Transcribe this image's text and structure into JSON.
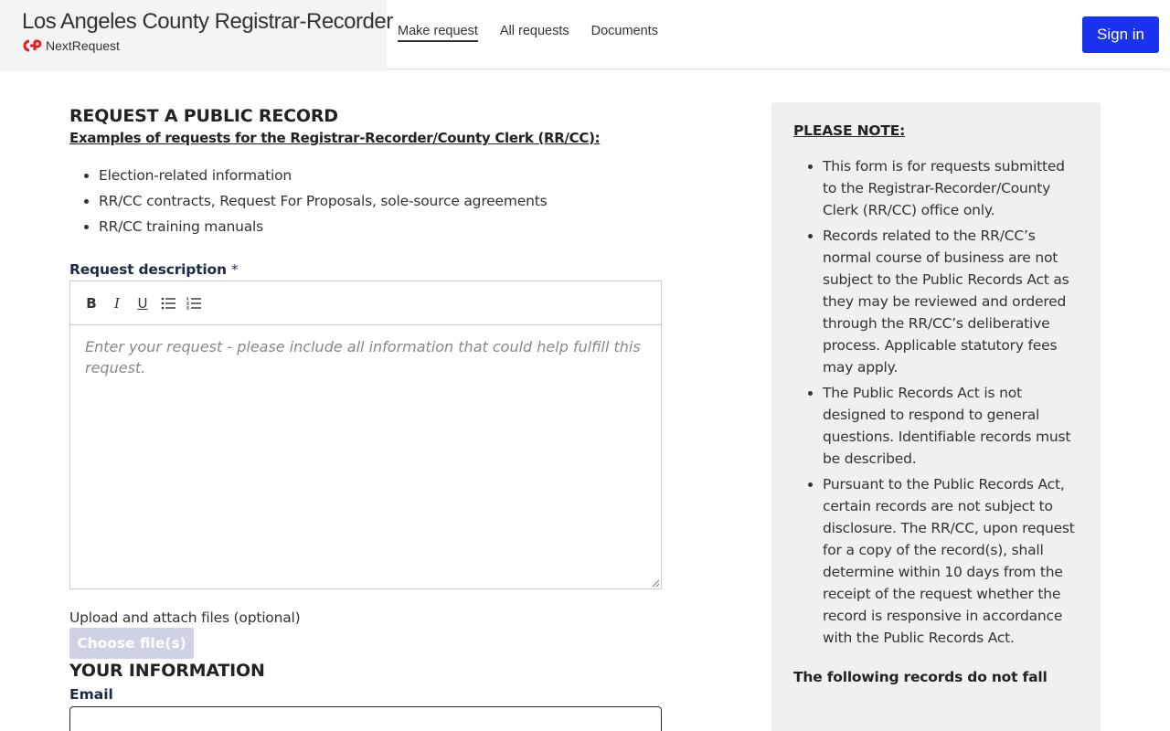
{
  "header": {
    "org_title": "Los Angeles County Registrar-Recorder",
    "product_name": "NextRequest",
    "logo_colors": {
      "red": "#e31b23",
      "dark": "#333333"
    },
    "nav": [
      {
        "label": "Make request",
        "active": true
      },
      {
        "label": "All requests",
        "active": false
      },
      {
        "label": "Documents",
        "active": false
      }
    ],
    "sign_in_label": "Sign in",
    "sign_in_color": "#1a33f0"
  },
  "main": {
    "title": "REQUEST A PUBLIC RECORD",
    "examples_heading": "Examples of requests for the Registrar-Recorder/County Clerk (RR/CC):",
    "examples": [
      "Election-related information",
      "RR/CC contracts, Request For Proposals, sole-source agreements",
      "RR/CC training manuals"
    ],
    "description_label": "Request description",
    "required_marker": "*",
    "toolbar": [
      {
        "icon": "bold-icon",
        "glyph": "B"
      },
      {
        "icon": "italic-icon",
        "glyph": "I"
      },
      {
        "icon": "underline-icon",
        "glyph": "U"
      },
      {
        "icon": "bullet-list-icon",
        "glyph": ""
      },
      {
        "icon": "numbered-list-icon",
        "glyph": ""
      }
    ],
    "description_placeholder": "Enter your request - please include all information that could help fulfill this request.",
    "upload_label": "Upload and attach files (optional)",
    "choose_files_label": "Choose file(s)",
    "your_info_title": "YOUR INFORMATION",
    "email_label": "Email",
    "email_value": ""
  },
  "sidebar": {
    "title": "PLEASE NOTE:",
    "items": [
      "This form is for requests submitted to the Registrar-Recorder/County Clerk (RR/CC) office only.",
      "Records related to the RR/CC’s normal course of business are not subject to the Public Records Act as they may be reviewed and ordered through the RR/CC’s deliberative process. Applicable statutory fees may apply.",
      "The Public Records Act is not designed to respond to general questions. Identifiable records must be described.",
      "Pursuant to the Public Records Act, certain records are not subject to disclosure. The RR/CC, upon request for a copy of the record(s), shall determine within 10 days from the receipt of the request whether the record is responsive in accordance with the Public Records Act."
    ],
    "footer_text": "The following records do not fall"
  }
}
